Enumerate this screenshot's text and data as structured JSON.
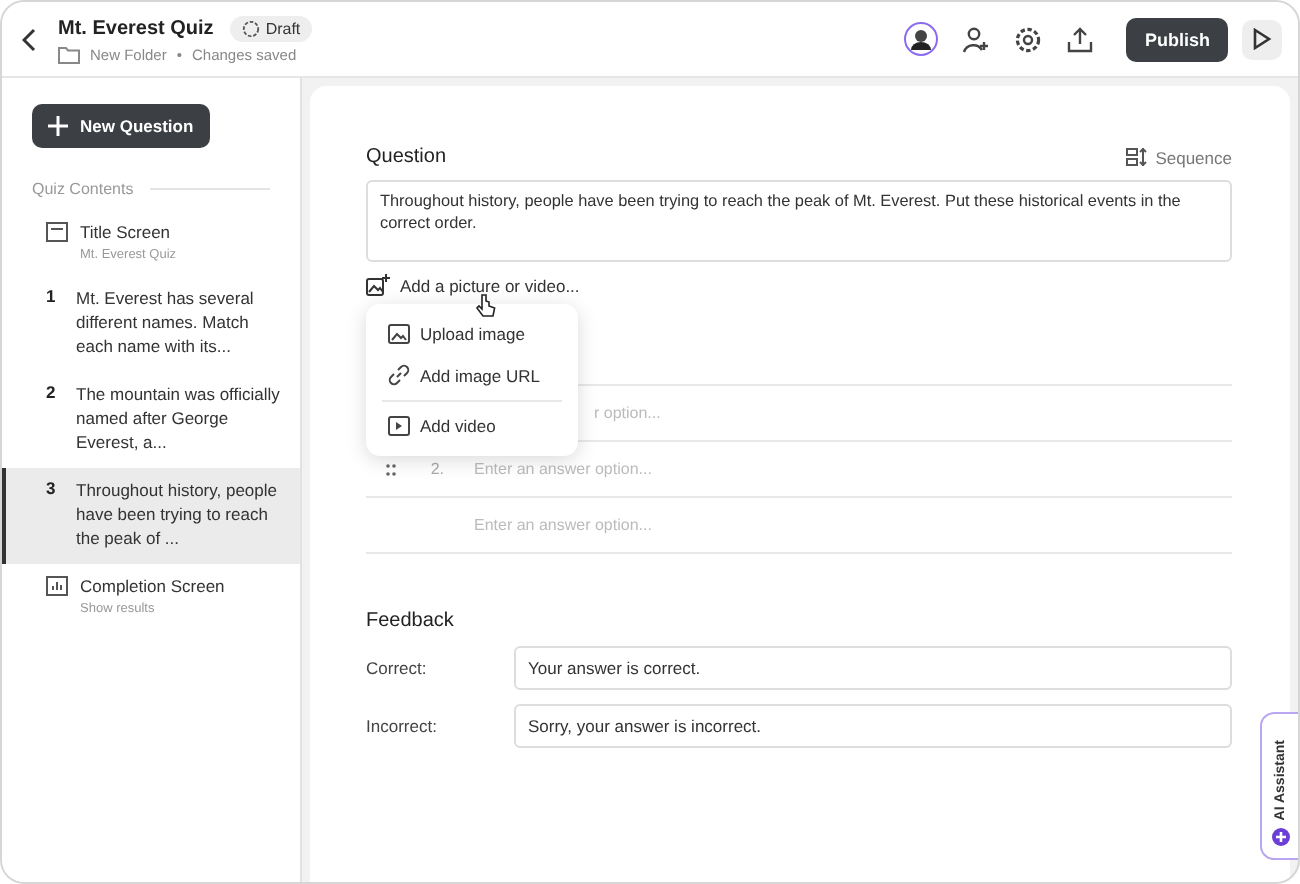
{
  "header": {
    "title": "Mt. Everest Quiz",
    "status": "Draft",
    "folder": "New Folder",
    "separator": "•",
    "save_state": "Changes saved",
    "publish": "Publish"
  },
  "sidebar": {
    "new_button": "New Question",
    "section": "Quiz Contents",
    "items": [
      {
        "kind": "title",
        "label": "Title Screen",
        "sub": "Mt. Everest Quiz",
        "selected": false
      },
      {
        "kind": "question",
        "number": "1",
        "label": "Mt. Everest has several different names. Match each name with its...",
        "selected": false
      },
      {
        "kind": "question",
        "number": "2",
        "label": "The mountain was officially named after George Everest, a...",
        "selected": false
      },
      {
        "kind": "question",
        "number": "3",
        "label": "Throughout history, people have been trying to reach the peak of ...",
        "selected": true
      },
      {
        "kind": "completion",
        "label": "Completion Screen",
        "sub": "Show results",
        "selected": false
      }
    ]
  },
  "question": {
    "heading": "Question",
    "type": "Sequence",
    "text": "Throughout history, people have been trying to reach the peak of Mt. Everest. Put these historical events in the correct order.",
    "add_media": "Add a picture or video..."
  },
  "media_menu": [
    {
      "kind": "image",
      "label": "Upload image"
    },
    {
      "kind": "link",
      "label": "Add image URL"
    },
    {
      "kind": "video",
      "label": "Add video"
    }
  ],
  "answers": [
    {
      "placeholder": "r option...",
      "handle": false
    },
    {
      "number": "2.",
      "placeholder": "Enter an answer option...",
      "handle": true
    },
    {
      "placeholder": "Enter an answer option...",
      "handle": false
    }
  ],
  "feedback": {
    "heading": "Feedback",
    "rows": [
      {
        "label": "Correct:",
        "value": "Your answer is correct."
      },
      {
        "label": "Incorrect:",
        "value": "Sorry, your answer is incorrect."
      }
    ]
  },
  "assistant": "AI Assistant"
}
